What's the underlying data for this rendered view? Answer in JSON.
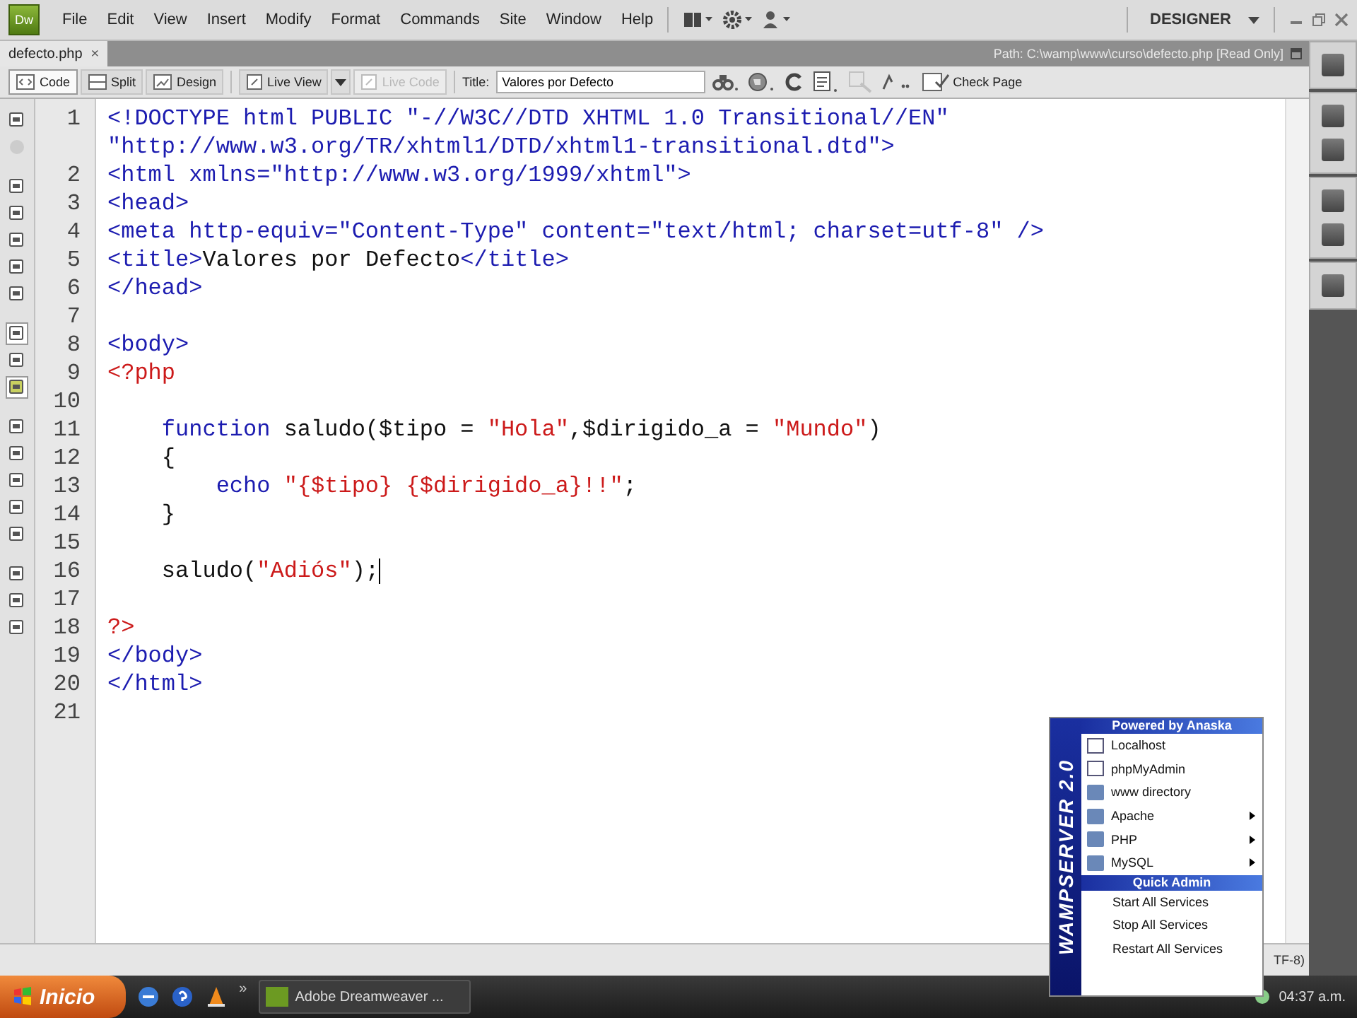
{
  "app": {
    "logo": "Dw",
    "menu": [
      "File",
      "Edit",
      "View",
      "Insert",
      "Modify",
      "Format",
      "Commands",
      "Site",
      "Window",
      "Help"
    ],
    "workspace": "DESIGNER"
  },
  "document_tab": {
    "label": "defecto.php",
    "close": "×",
    "path": "Path:  C:\\wamp\\www\\curso\\defecto.php  [Read Only]"
  },
  "toolbar": {
    "views": [
      {
        "label": "Code",
        "selected": true
      },
      {
        "label": "Split",
        "selected": false
      },
      {
        "label": "Design",
        "selected": false
      }
    ],
    "live_view": {
      "label": "Live View",
      "disabled": false
    },
    "live_code": {
      "label": "Live Code",
      "disabled": true
    },
    "title_label": "Title:",
    "title_value": "Valores por Defecto",
    "check_page": "Check Page"
  },
  "code": {
    "lines": [
      {
        "number": "1",
        "segments": [
          {
            "kind": "tag",
            "text": "<!DOCTYPE html PUBLIC \"-//W3C//DTD XHTML 1.0 Transitional//EN\" \"http://www.w3.org/TR/xhtml1/DTD/xhtml1-transitional.dtd\">"
          }
        ]
      },
      {
        "number": "2",
        "segments": [
          {
            "kind": "tag",
            "text": "<html xmlns=\"http://www.w3.org/1999/xhtml\">"
          }
        ]
      },
      {
        "number": "3",
        "segments": [
          {
            "kind": "tag",
            "text": "<head>"
          }
        ]
      },
      {
        "number": "4",
        "segments": [
          {
            "kind": "tag",
            "text": "<meta http-equiv=\"Content-Type\" content=\"text/html; charset=utf-8\" />"
          }
        ]
      },
      {
        "number": "5",
        "segments": [
          {
            "kind": "tag",
            "text": "<title>"
          },
          {
            "kind": "plain",
            "text": "Valores por Defecto"
          },
          {
            "kind": "tag",
            "text": "</title>"
          }
        ]
      },
      {
        "number": "6",
        "segments": [
          {
            "kind": "tag",
            "text": "</head>"
          }
        ]
      },
      {
        "number": "7"
      },
      {
        "number": "8",
        "segments": [
          {
            "kind": "tag",
            "text": "<body>"
          }
        ]
      },
      {
        "number": "9",
        "segments": [
          {
            "kind": "php",
            "text": "<?php"
          }
        ]
      },
      {
        "number": "10"
      },
      {
        "number": "11",
        "segments": [
          {
            "kind": "keyword",
            "text": "    function"
          },
          {
            "kind": "plain",
            "text": " saludo($tipo = "
          },
          {
            "kind": "string",
            "text": "\"Hola\""
          },
          {
            "kind": "plain",
            "text": ",$dirigido_a = "
          },
          {
            "kind": "string",
            "text": "\"Mundo\""
          },
          {
            "kind": "plain",
            "text": ")"
          }
        ]
      },
      {
        "number": "12",
        "segments": [
          {
            "kind": "plain",
            "text": "    {"
          }
        ]
      },
      {
        "number": "13",
        "segments": [
          {
            "kind": "keyword",
            "text": "        echo"
          },
          {
            "kind": "string",
            "text": " \"{$tipo} {$dirigido_a}!!\""
          },
          {
            "kind": "plain",
            "text": ";"
          }
        ]
      },
      {
        "number": "14",
        "segments": [
          {
            "kind": "plain",
            "text": "    }"
          }
        ]
      },
      {
        "number": "15"
      },
      {
        "number": "16",
        "caret": true,
        "segments": [
          {
            "kind": "plain",
            "text": "    saludo("
          },
          {
            "kind": "string",
            "text": "\"Adiós\""
          },
          {
            "kind": "plain",
            "text": ");"
          }
        ]
      },
      {
        "number": "17"
      },
      {
        "number": "18",
        "segments": [
          {
            "kind": "php",
            "text": "?>"
          }
        ]
      },
      {
        "number": "19",
        "segments": [
          {
            "kind": "tag",
            "text": "</body>"
          }
        ]
      },
      {
        "number": "20",
        "segments": [
          {
            "kind": "tag",
            "text": "</html>"
          }
        ]
      },
      {
        "number": "21"
      }
    ]
  },
  "status_bar": {
    "encoding": "TF-8)"
  },
  "tray_menu": {
    "brand": "WAMPSERVER 2.0",
    "header": "Powered by Anaska",
    "items": [
      {
        "label": "Localhost",
        "kind": "page",
        "submenu": false
      },
      {
        "label": "phpMyAdmin",
        "kind": "page",
        "submenu": false
      },
      {
        "label": "www directory",
        "kind": "folder",
        "submenu": false
      },
      {
        "label": "Apache",
        "kind": "folder",
        "submenu": true
      },
      {
        "label": "PHP",
        "kind": "folder",
        "submenu": true
      },
      {
        "label": "MySQL",
        "kind": "folder",
        "submenu": true
      }
    ],
    "section": "Quick Admin",
    "actions": [
      "Start All Services",
      "Stop All Services",
      "Restart All Services"
    ]
  },
  "taskbar": {
    "start": "Inicio",
    "more": "»",
    "task": "Adobe Dreamweaver ...",
    "clock": "04:37 a.m."
  }
}
